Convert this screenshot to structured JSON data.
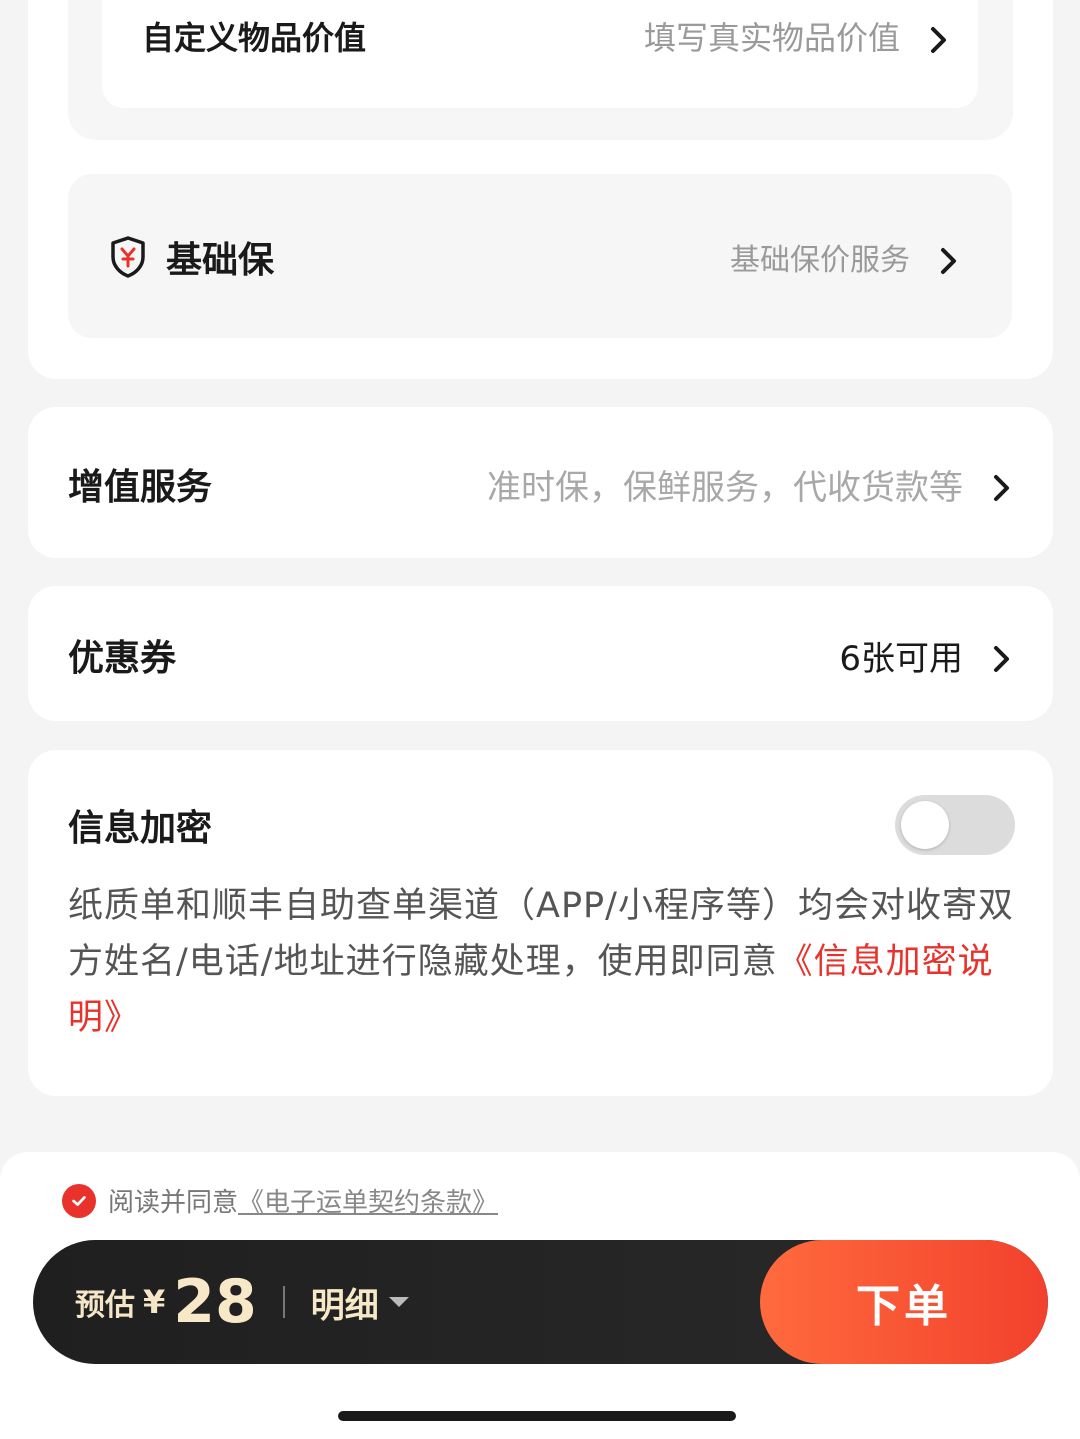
{
  "custom_value": {
    "label": "自定义物品价值",
    "hint": "填写真实物品价值"
  },
  "insurance": {
    "label": "基础保",
    "hint": "基础保价服务",
    "icon": "shield-yen-icon"
  },
  "value_added": {
    "label": "增值服务",
    "hint": "准时保，保鲜服务，代收货款等"
  },
  "coupon": {
    "label": "优惠券",
    "value": "6张可用"
  },
  "encryption": {
    "label": "信息加密",
    "toggle_on": false,
    "description": "纸质单和顺丰自助查单渠道（APP/小程序等）均会对收寄双方姓名/电话/地址进行隐藏处理，使用即同意",
    "link": "《信息加密说明》"
  },
  "agreement": {
    "checked": true,
    "text": "阅读并同意",
    "link": "《电子运单契约条款》"
  },
  "order_bar": {
    "estimate_label": "预估",
    "currency": "¥",
    "price": "28",
    "detail_label": "明细",
    "submit_label": "下单"
  },
  "colors": {
    "accent_red": "#e8322b",
    "order_gradient_start": "#ff6a3d",
    "order_gradient_end": "#f2412d",
    "price_gold": "#f7e9c8"
  }
}
